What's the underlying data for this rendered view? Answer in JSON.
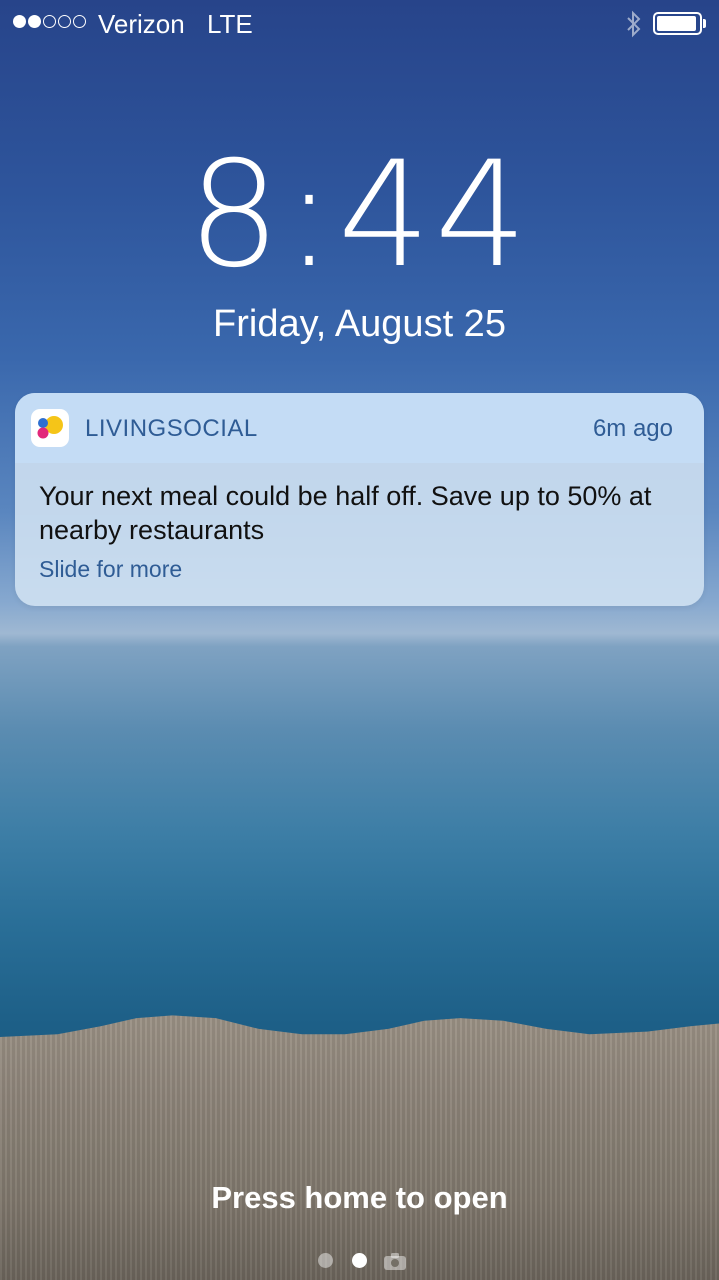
{
  "status_bar": {
    "signal": {
      "filled": 2,
      "total": 5
    },
    "carrier": "Verizon",
    "network": "LTE",
    "bluetooth_icon": "bluetooth-icon",
    "battery_level": 0.95
  },
  "lock_screen": {
    "time": "8:44",
    "date": "Friday, August 25"
  },
  "notification": {
    "app_name": "LIVINGSOCIAL",
    "time_ago": "6m ago",
    "message": "Your next meal could be half off. Save up to 50% at nearby restaurants",
    "action_hint": "Slide for more",
    "icon": "livingsocial-app-icon"
  },
  "footer": {
    "prompt": "Press home to open",
    "page_indicator": {
      "pages": 2,
      "active_index": 1
    },
    "camera_icon": "camera-icon"
  },
  "colors": {
    "notification_accent": "#2f5c95",
    "icon_yellow": "#f5c518",
    "icon_pink": "#e2287a",
    "icon_blue": "#2e6fd0"
  }
}
